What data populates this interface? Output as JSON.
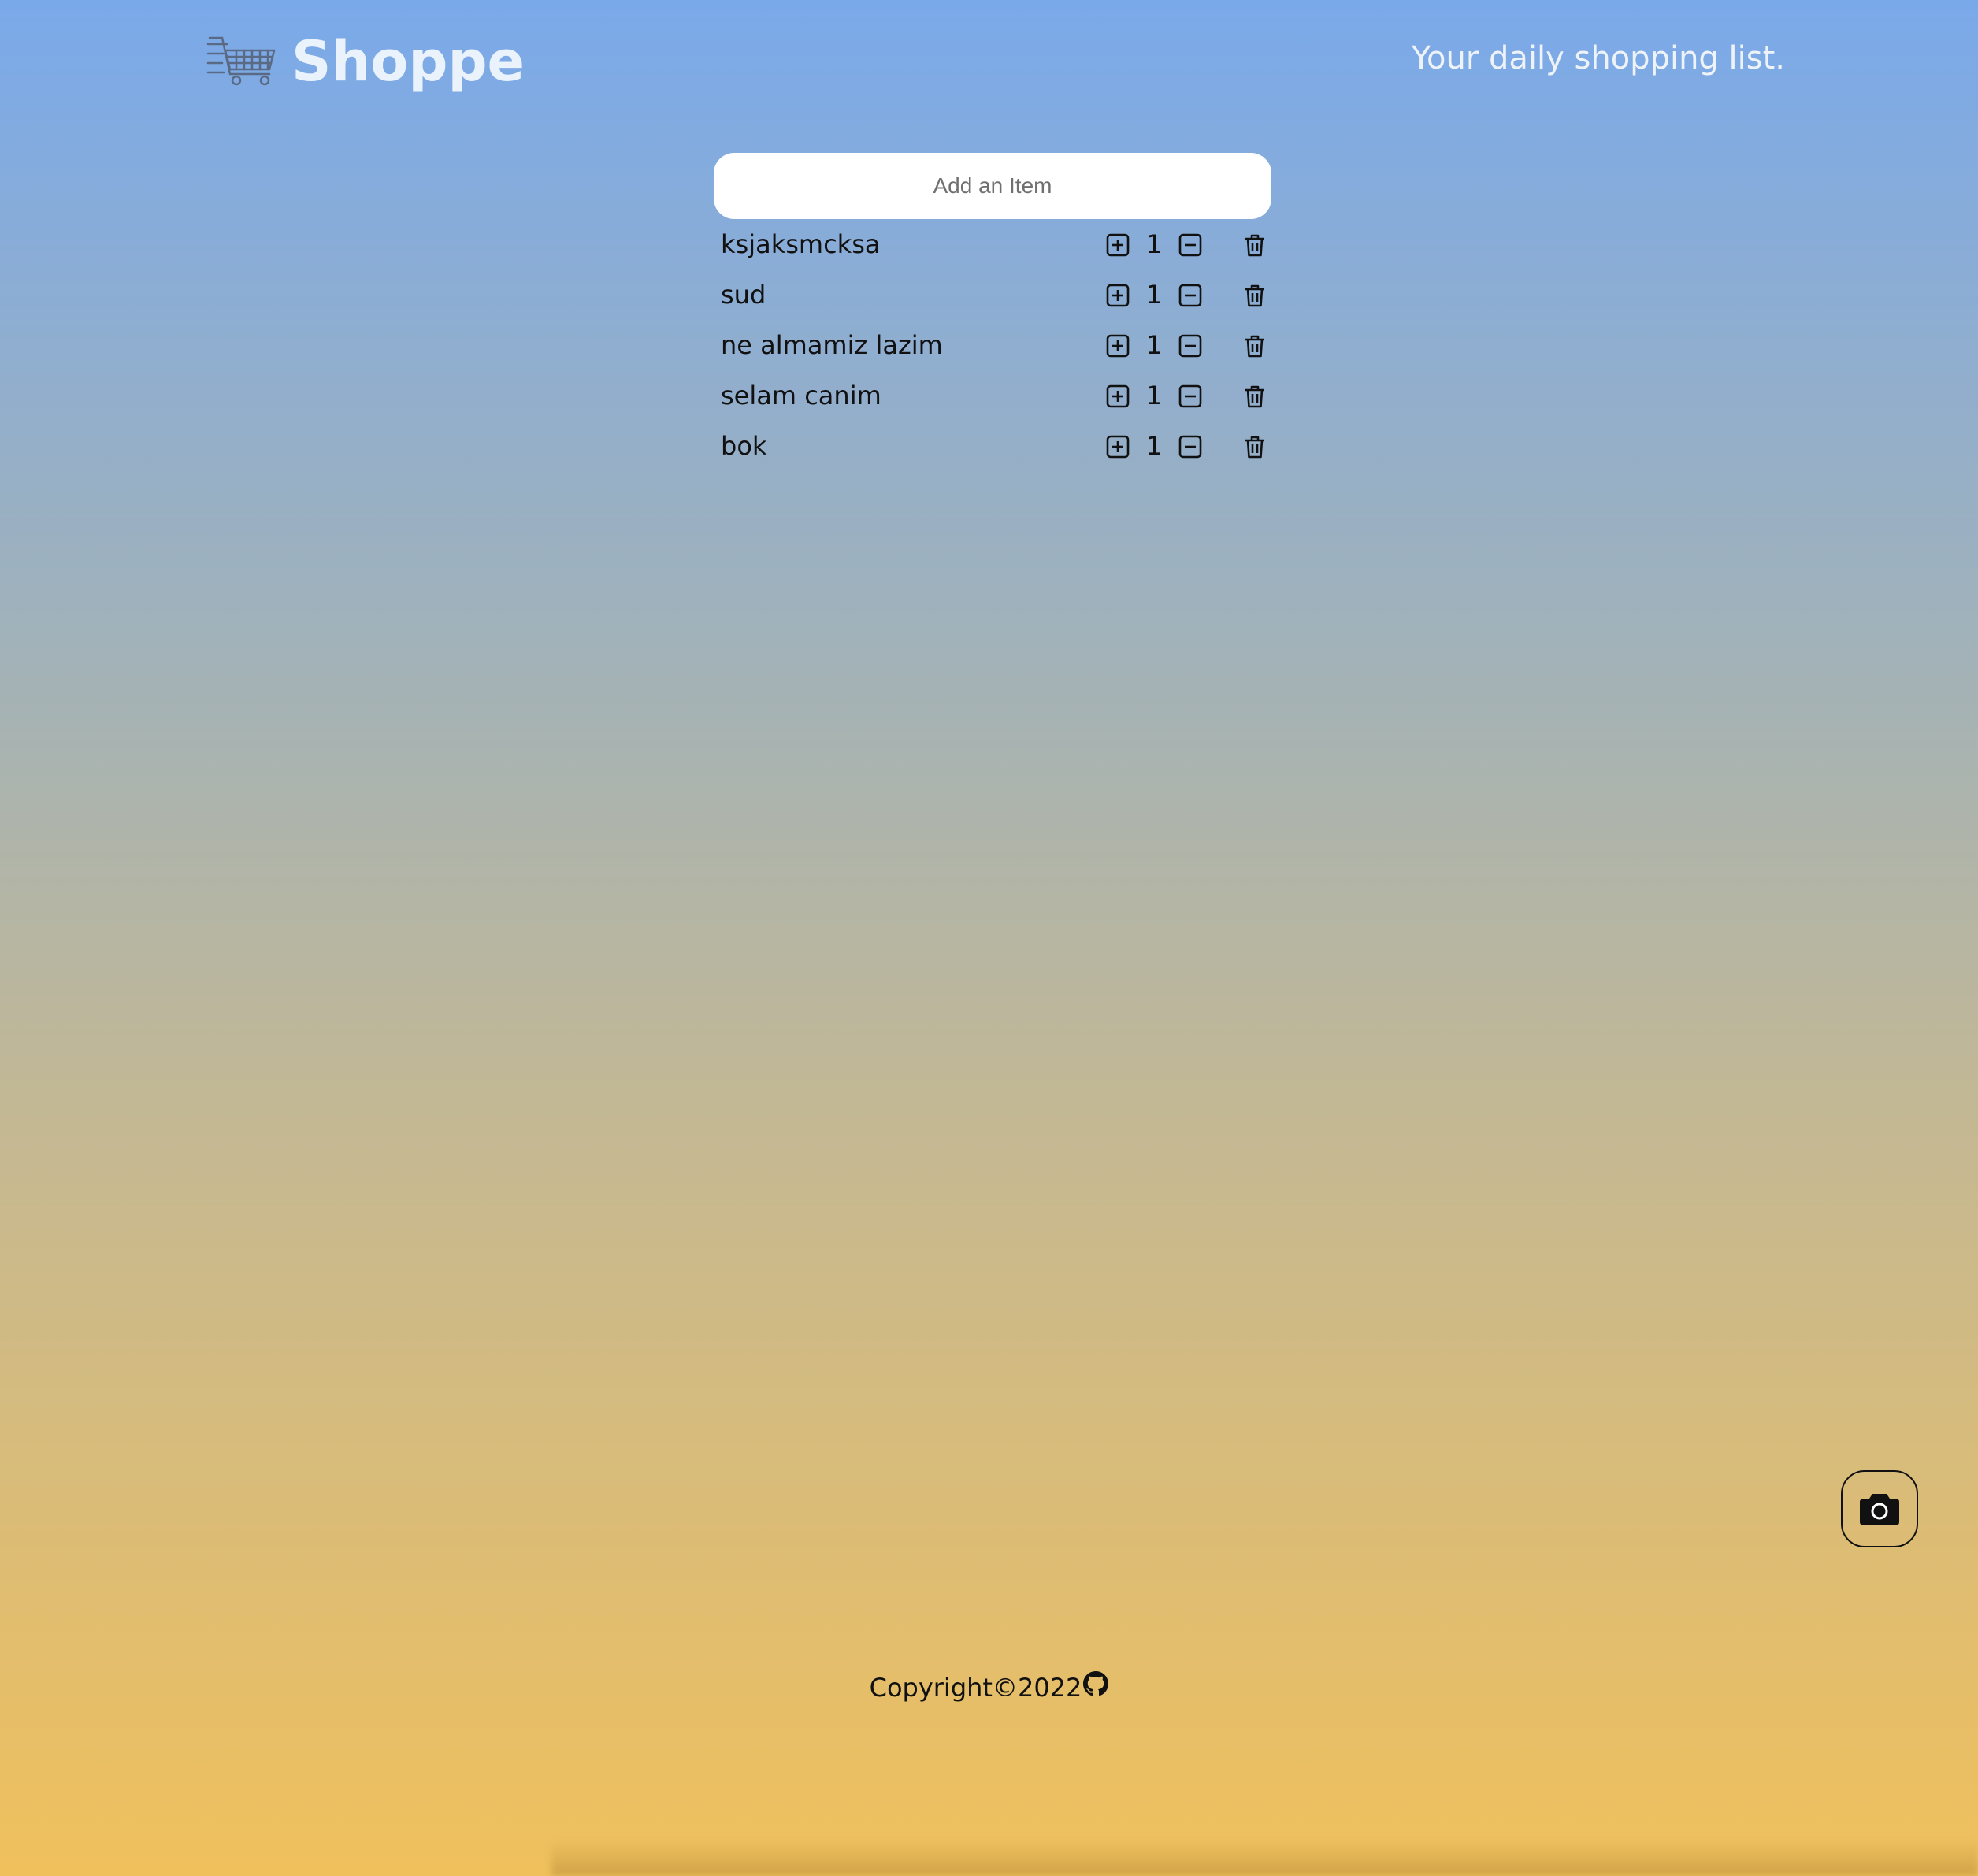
{
  "header": {
    "title": "Shoppe",
    "tagline": "Your daily shopping list.",
    "logo_icon": "shopping-cart-icon"
  },
  "add_item": {
    "placeholder": "Add an Item",
    "value": ""
  },
  "items": [
    {
      "name": "ksjaksmcksa",
      "quantity": "1"
    },
    {
      "name": "sud",
      "quantity": "1"
    },
    {
      "name": "ne almamiz lazim",
      "quantity": "1"
    },
    {
      "name": "selam canim",
      "quantity": "1"
    },
    {
      "name": "bok",
      "quantity": "1"
    }
  ],
  "icons": {
    "increase": "plus-square-icon",
    "decrease": "minus-square-icon",
    "delete": "trash-icon",
    "camera": "camera-icon",
    "github": "github-icon"
  },
  "footer": {
    "copyright": "Copyright©2022"
  },
  "colors": {
    "gradient_top": "#7aa9ea",
    "gradient_bottom": "#f0c05c",
    "title": "#eaf2fb",
    "text": "#111111"
  }
}
